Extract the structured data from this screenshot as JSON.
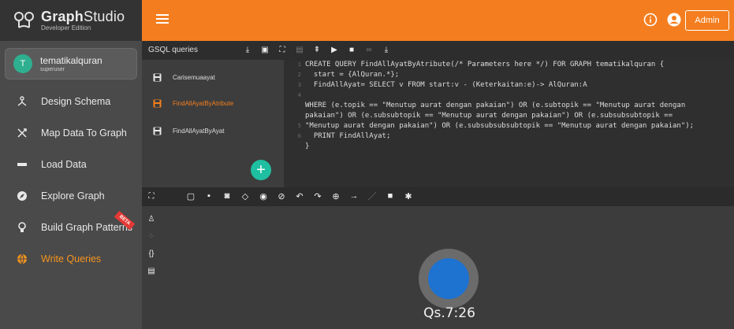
{
  "app": {
    "title_bold": "Graph",
    "title_light": "Studio",
    "edition": "Developer Edition",
    "accent": "#f47e1f"
  },
  "user": {
    "initial": "T",
    "name": "tematikalquran",
    "role": "superuser"
  },
  "nav": [
    {
      "label": "Design Schema",
      "icon": "design-schema-icon"
    },
    {
      "label": "Map Data To Graph",
      "icon": "map-data-icon"
    },
    {
      "label": "Load Data",
      "icon": "load-data-icon"
    },
    {
      "label": "Explore Graph",
      "icon": "explore-icon"
    },
    {
      "label": "Build Graph Patterns",
      "icon": "lightbulb-icon",
      "badge": "BETA"
    },
    {
      "label": "Write Queries",
      "icon": "globe-icon"
    }
  ],
  "header": {
    "admin_label": "Admin"
  },
  "queries_panel": {
    "title": "GSQL queries",
    "items": [
      {
        "name": "Carisemuaayat"
      },
      {
        "name": "FindAllAyatByAtribute"
      },
      {
        "name": "FindAllAyatByAyat"
      }
    ]
  },
  "editor": {
    "line_numbers": [
      "1",
      "2",
      "3",
      "4",
      "5",
      "6",
      "7"
    ],
    "lines": [
      "CREATE QUERY FindAllAyatByAtribute(/* Parameters here */) FOR GRAPH tematikalquran {",
      "  start = {AlQuran.*};",
      "  FindAllAyat= SELECT v FROM start:v - (Keterkaitan:e)-> AlQuran:A",
      "",
      "WHERE (e.topik == \"Menutup aurat dengan pakaian\") OR (e.subtopik == \"Menutup aurat dengan",
      "pakaian\") OR (e.subsubtopik == \"Menutup aurat dengan pakaian\") OR (e.subsubsubtopik ==",
      "\"Menutup aurat dengan pakaian\") OR (e.subsubsubsubtopik == \"Menutup aurat dengan pakaian\");",
      "  PRINT FindAllAyat;",
      "}"
    ]
  },
  "graph": {
    "node_label": "Qs.7:26",
    "node_color": "#1e72d0"
  }
}
